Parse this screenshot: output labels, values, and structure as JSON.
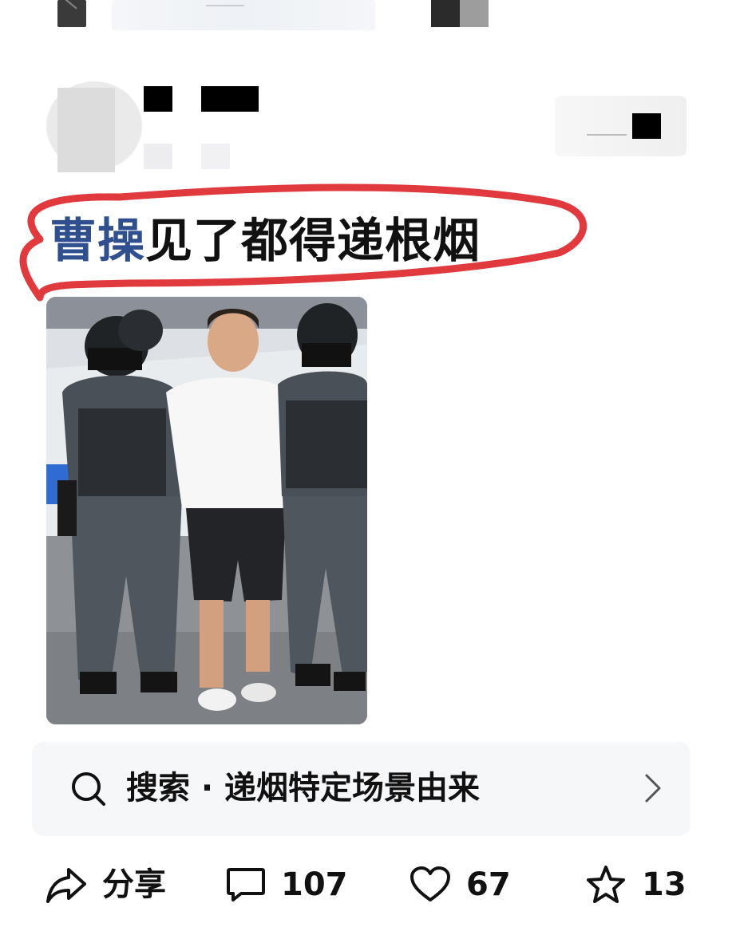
{
  "post": {
    "headline_link": "曹操",
    "headline_rest": "见了都得递根烟"
  },
  "search": {
    "icon": "search-icon",
    "text": "搜索 · 递烟特定场景由来",
    "chevron": "chevron-right-icon"
  },
  "actions": {
    "share_label": "分享",
    "comment_count": "107",
    "like_count": "67",
    "favorite_count": "13"
  },
  "colors": {
    "link_blue": "#2f4f8f",
    "annotation_red": "#e0393e",
    "text": "#111111"
  }
}
